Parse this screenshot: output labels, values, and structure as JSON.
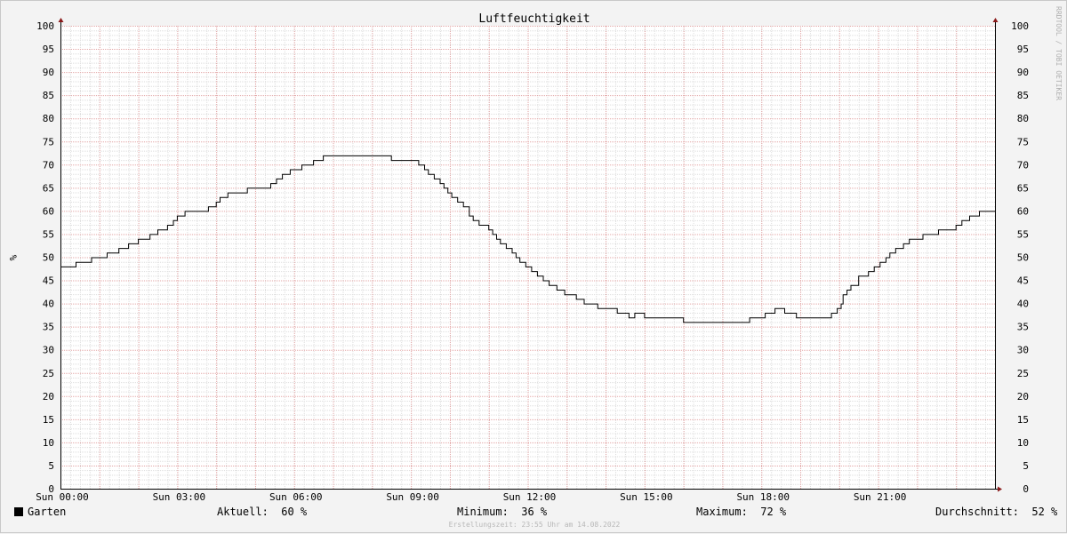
{
  "chart_data": {
    "type": "line",
    "title": "Luftfeuchtigkeit",
    "ylabel": "%",
    "ylim": [
      0,
      100
    ],
    "y_ticks": [
      "0",
      "5",
      "10",
      "15",
      "20",
      "25",
      "30",
      "35",
      "40",
      "45",
      "50",
      "55",
      "60",
      "65",
      "70",
      "75",
      "80",
      "85",
      "90",
      "95",
      "100"
    ],
    "x_ticks": [
      {
        "hour": 0,
        "label": "Sun 00:00"
      },
      {
        "hour": 3,
        "label": "Sun 03:00"
      },
      {
        "hour": 6,
        "label": "Sun 06:00"
      },
      {
        "hour": 9,
        "label": "Sun 09:00"
      },
      {
        "hour": 12,
        "label": "Sun 12:00"
      },
      {
        "hour": 15,
        "label": "Sun 15:00"
      },
      {
        "hour": 18,
        "label": "Sun 18:00"
      },
      {
        "hour": 21,
        "label": "Sun 21:00"
      }
    ],
    "xlim_hours": [
      0,
      24
    ],
    "grid": true,
    "watermark": "RRDTOOL / TOBI OETIKER",
    "series": [
      {
        "name": "Garten",
        "color": "#000000",
        "step": true,
        "points": [
          [
            0.0,
            48
          ],
          [
            0.4,
            49
          ],
          [
            0.8,
            50
          ],
          [
            1.2,
            51
          ],
          [
            1.5,
            52
          ],
          [
            1.75,
            53
          ],
          [
            2.0,
            54
          ],
          [
            2.3,
            55
          ],
          [
            2.5,
            56
          ],
          [
            2.75,
            57
          ],
          [
            2.9,
            58
          ],
          [
            3.0,
            59
          ],
          [
            3.2,
            60
          ],
          [
            3.8,
            61
          ],
          [
            4.0,
            62
          ],
          [
            4.1,
            63
          ],
          [
            4.3,
            64
          ],
          [
            4.8,
            65
          ],
          [
            5.4,
            66
          ],
          [
            5.55,
            67
          ],
          [
            5.7,
            68
          ],
          [
            5.9,
            69
          ],
          [
            6.2,
            70
          ],
          [
            6.5,
            71
          ],
          [
            6.75,
            72
          ],
          [
            8.5,
            71
          ],
          [
            9.2,
            70
          ],
          [
            9.35,
            69
          ],
          [
            9.45,
            68
          ],
          [
            9.6,
            67
          ],
          [
            9.75,
            66
          ],
          [
            9.85,
            65
          ],
          [
            9.95,
            64
          ],
          [
            10.05,
            63
          ],
          [
            10.2,
            62
          ],
          [
            10.35,
            61
          ],
          [
            10.5,
            59
          ],
          [
            10.6,
            58
          ],
          [
            10.75,
            57
          ],
          [
            11.0,
            56
          ],
          [
            11.1,
            55
          ],
          [
            11.2,
            54
          ],
          [
            11.3,
            53
          ],
          [
            11.45,
            52
          ],
          [
            11.6,
            51
          ],
          [
            11.7,
            50
          ],
          [
            11.8,
            49
          ],
          [
            11.95,
            48
          ],
          [
            12.1,
            47
          ],
          [
            12.25,
            46
          ],
          [
            12.4,
            45
          ],
          [
            12.55,
            44
          ],
          [
            12.75,
            43
          ],
          [
            12.95,
            42
          ],
          [
            13.25,
            41
          ],
          [
            13.45,
            40
          ],
          [
            13.8,
            39
          ],
          [
            14.3,
            38
          ],
          [
            14.6,
            37
          ],
          [
            14.75,
            38
          ],
          [
            15.0,
            37
          ],
          [
            16.0,
            36
          ],
          [
            17.7,
            37
          ],
          [
            18.1,
            38
          ],
          [
            18.35,
            39
          ],
          [
            18.6,
            38
          ],
          [
            18.9,
            37
          ],
          [
            19.8,
            38
          ],
          [
            19.95,
            39
          ],
          [
            20.05,
            40
          ],
          [
            20.1,
            42
          ],
          [
            20.2,
            43
          ],
          [
            20.3,
            44
          ],
          [
            20.5,
            46
          ],
          [
            20.75,
            47
          ],
          [
            20.9,
            48
          ],
          [
            21.05,
            49
          ],
          [
            21.2,
            50
          ],
          [
            21.3,
            51
          ],
          [
            21.45,
            52
          ],
          [
            21.65,
            53
          ],
          [
            21.8,
            54
          ],
          [
            22.15,
            55
          ],
          [
            22.55,
            56
          ],
          [
            23.0,
            57
          ],
          [
            23.15,
            58
          ],
          [
            23.35,
            59
          ],
          [
            23.6,
            60
          ],
          [
            23.85,
            60
          ]
        ]
      }
    ]
  },
  "legend": {
    "label": "Garten",
    "color": "#000000"
  },
  "stats": {
    "current_label": "Aktuell:",
    "current_value": "60 %",
    "min_label": "Minimum:",
    "min_value": "36 %",
    "max_label": "Maximum:",
    "max_value": "72 %",
    "avg_label": "Durchschnitt:",
    "avg_value": "52 %"
  },
  "timestamp": "Erstellungszeit: 23:55 Uhr am 14.08.2022"
}
